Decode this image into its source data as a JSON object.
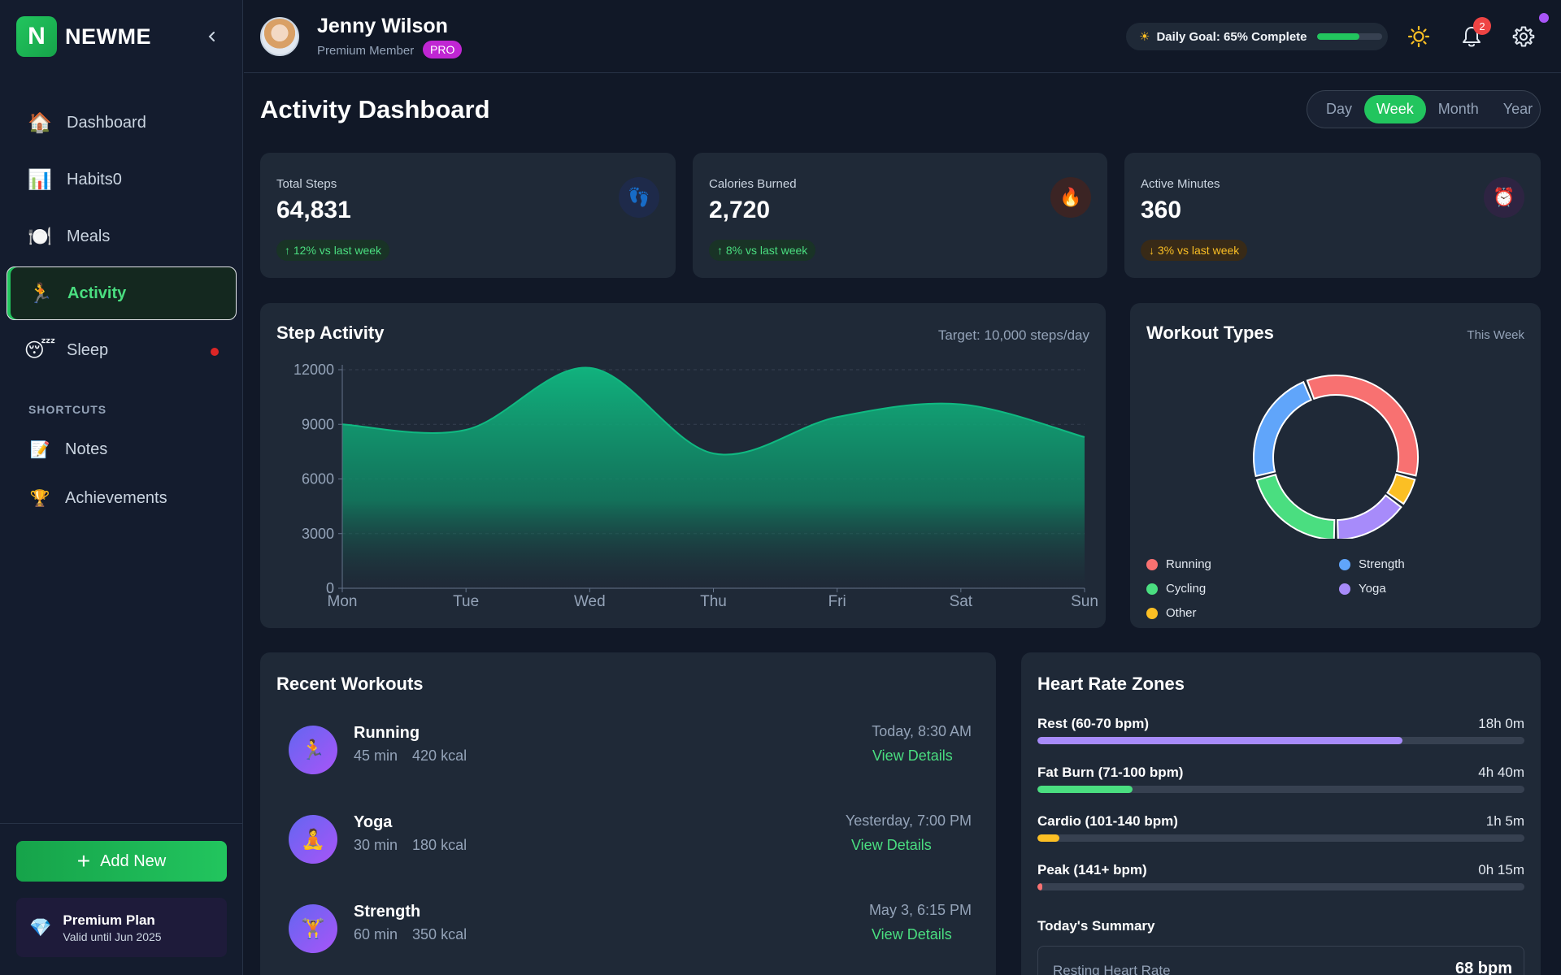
{
  "app": {
    "logo_letter": "N",
    "name": "NEWME"
  },
  "sidebar": {
    "items": [
      {
        "label": "Dashboard",
        "icon": "🏠",
        "icon_name": "house-icon"
      },
      {
        "label": "Habits0",
        "icon": "📊",
        "icon_name": "bar-chart-icon"
      },
      {
        "label": "Meals",
        "icon": "🍽️",
        "icon_name": "plate-icon"
      },
      {
        "label": "Activity",
        "icon": "🏃",
        "icon_name": "runner-icon",
        "active": true
      },
      {
        "label": "Sleep",
        "icon": "😴",
        "icon_name": "sleeping-face-icon",
        "alert_dot": true
      }
    ],
    "shortcuts_title": "SHORTCUTS",
    "shortcuts": [
      {
        "label": "Notes",
        "icon": "📝",
        "icon_name": "memo-icon"
      },
      {
        "label": "Achievements",
        "icon": "🏆",
        "icon_name": "trophy-icon"
      }
    ],
    "add_button": "Add New",
    "plan": {
      "title": "Premium Plan",
      "subtitle": "Valid until Jun 2025",
      "icon": "💎"
    }
  },
  "header": {
    "user_name": "Jenny Wilson",
    "user_role": "Premium Member",
    "badge": "PRO",
    "goal_text": "Daily Goal: 65% Complete",
    "goal_progress": 0.65,
    "notification_count": "2"
  },
  "main": {
    "title": "Activity Dashboard",
    "periods": [
      "Day",
      "Week",
      "Month",
      "Year"
    ],
    "selected_period": "Week"
  },
  "stats": [
    {
      "label": "Total Steps",
      "value": "64,831",
      "change": "↑ 12% vs last week",
      "trend": "up",
      "icon": "👣",
      "icon_name": "footprints-icon",
      "icon_bg": "#1e2a4a"
    },
    {
      "label": "Calories Burned",
      "value": "2,720",
      "change": "↑ 8% vs last week",
      "trend": "up",
      "icon": "🔥",
      "icon_name": "fire-icon",
      "icon_bg": "#3b2424"
    },
    {
      "label": "Active Minutes",
      "value": "360",
      "change": "↓ 3% vs last week",
      "trend": "down",
      "icon": "⏰",
      "icon_name": "alarm-clock-icon",
      "icon_bg": "#2e2442"
    }
  ],
  "step_activity": {
    "title": "Step Activity",
    "target": "Target: 10,000 steps/day"
  },
  "workout_types": {
    "title": "Workout Types",
    "period": "This Week"
  },
  "recent_workouts": {
    "title": "Recent Workouts",
    "items": [
      {
        "name": "Running",
        "duration": "45 min",
        "calories": "420 kcal",
        "time": "Today, 8:30 AM",
        "link": "View Details",
        "icon": "🏃",
        "icon_name": "runner-icon"
      },
      {
        "name": "Yoga",
        "duration": "30 min",
        "calories": "180 kcal",
        "time": "Yesterday, 7:00 PM",
        "link": "View Details",
        "icon": "🧘",
        "icon_name": "yoga-icon"
      },
      {
        "name": "Strength",
        "duration": "60 min",
        "calories": "350 kcal",
        "time": "May 3, 6:15 PM",
        "link": "View Details",
        "icon": "🏋️",
        "icon_name": "weightlifter-icon"
      }
    ]
  },
  "heart_rate": {
    "title": "Heart Rate Zones",
    "zones": [
      {
        "label": "Rest (60-70 bpm)",
        "value": "18h 0m",
        "fraction": 0.75,
        "color": "#a78bfa"
      },
      {
        "label": "Fat Burn (71-100 bpm)",
        "value": "4h 40m",
        "fraction": 0.195,
        "color": "#4ade80"
      },
      {
        "label": "Cardio (101-140 bpm)",
        "value": "1h 5m",
        "fraction": 0.045,
        "color": "#fbbf24"
      },
      {
        "label": "Peak (141+ bpm)",
        "value": "0h 15m",
        "fraction": 0.01,
        "color": "#f87171"
      }
    ],
    "summary_title": "Today's Summary",
    "summary_label": "Resting Heart Rate",
    "summary_value": "68 bpm"
  },
  "chart_data": [
    {
      "type": "area",
      "title": "Step Activity",
      "categories": [
        "Mon",
        "Tue",
        "Wed",
        "Thu",
        "Fri",
        "Sat",
        "Sun"
      ],
      "values": [
        9000,
        8700,
        12100,
        7400,
        9400,
        10100,
        8300
      ],
      "yticks": [
        0,
        3000,
        6000,
        9000,
        12000
      ],
      "ylim": [
        0,
        12000
      ],
      "grid": true,
      "color": "#10b981"
    },
    {
      "type": "pie",
      "title": "Workout Types",
      "subtitle": "This Week",
      "legend_position": "bottom",
      "series": [
        {
          "name": "Running",
          "value": 35,
          "color": "#f87171"
        },
        {
          "name": "Other",
          "value": 6,
          "color": "#fbbf24"
        },
        {
          "name": "Yoga",
          "value": 15,
          "color": "#a78bfa"
        },
        {
          "name": "Cycling",
          "value": 21,
          "color": "#4ade80"
        },
        {
          "name": "Strength",
          "value": 23,
          "color": "#60a5fa"
        }
      ],
      "legend": [
        "Running",
        "Strength",
        "Cycling",
        "Yoga",
        "Other"
      ]
    }
  ]
}
